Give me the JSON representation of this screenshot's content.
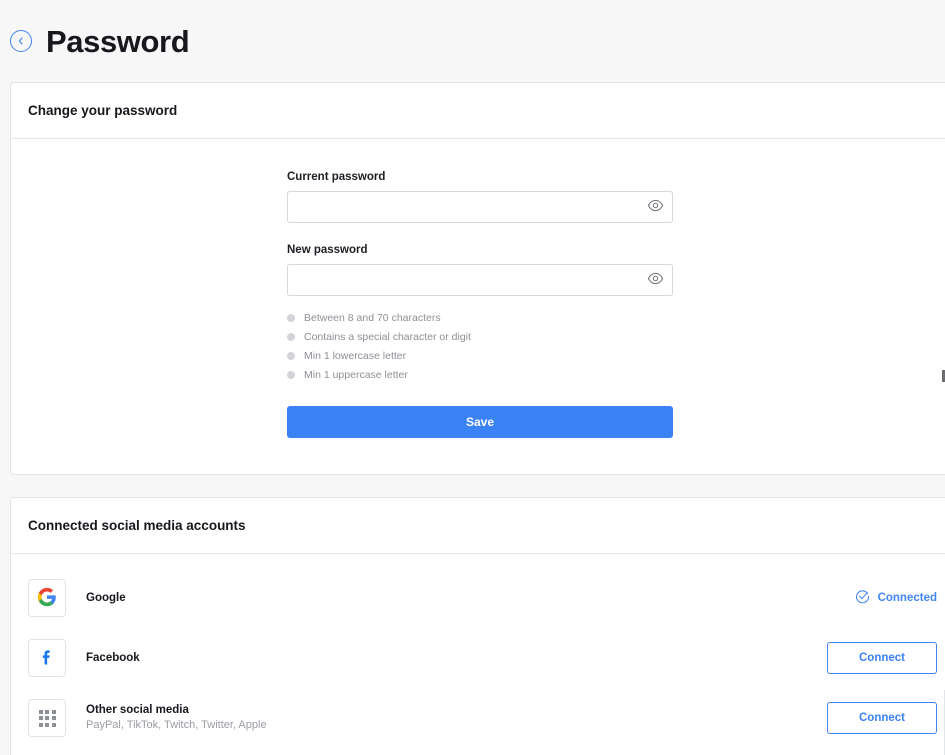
{
  "header": {
    "back_icon": "chevron-left-circle-icon",
    "title": "Password"
  },
  "password_card": {
    "header_title": "Change your password",
    "current_password": {
      "label": "Current password",
      "value": "",
      "placeholder": "",
      "toggle_icon": "eye-icon"
    },
    "new_password": {
      "label": "New password",
      "value": "",
      "placeholder": "",
      "toggle_icon": "eye-icon"
    },
    "requirements": [
      "Between 8 and 70 characters",
      "Contains a special character or digit",
      "Min 1 lowercase letter",
      "Min 1 uppercase letter"
    ],
    "save_label": "Save"
  },
  "social_card": {
    "header_title": "Connected social media accounts",
    "accounts": [
      {
        "name": "Google",
        "subtitle": "",
        "logo": "google-logo-icon",
        "status": "Connected",
        "status_icon": "check-circle-icon",
        "action": "status"
      },
      {
        "name": "Facebook",
        "subtitle": "",
        "logo": "facebook-logo-icon",
        "button_label": "Connect",
        "action": "button"
      },
      {
        "name": "Other social media",
        "subtitle": "PayPal, TikTok, Twitch, Twitter, Apple",
        "logo": "grid-apps-icon",
        "button_label": "Connect",
        "action": "button"
      }
    ]
  },
  "colors": {
    "accent_blue": "#3b82f6",
    "link_blue": "#4285f4",
    "page_background": "#f7f7f8",
    "card_background": "#ffffff",
    "border": "#e3e4e8",
    "muted_text": "#8e9097"
  }
}
